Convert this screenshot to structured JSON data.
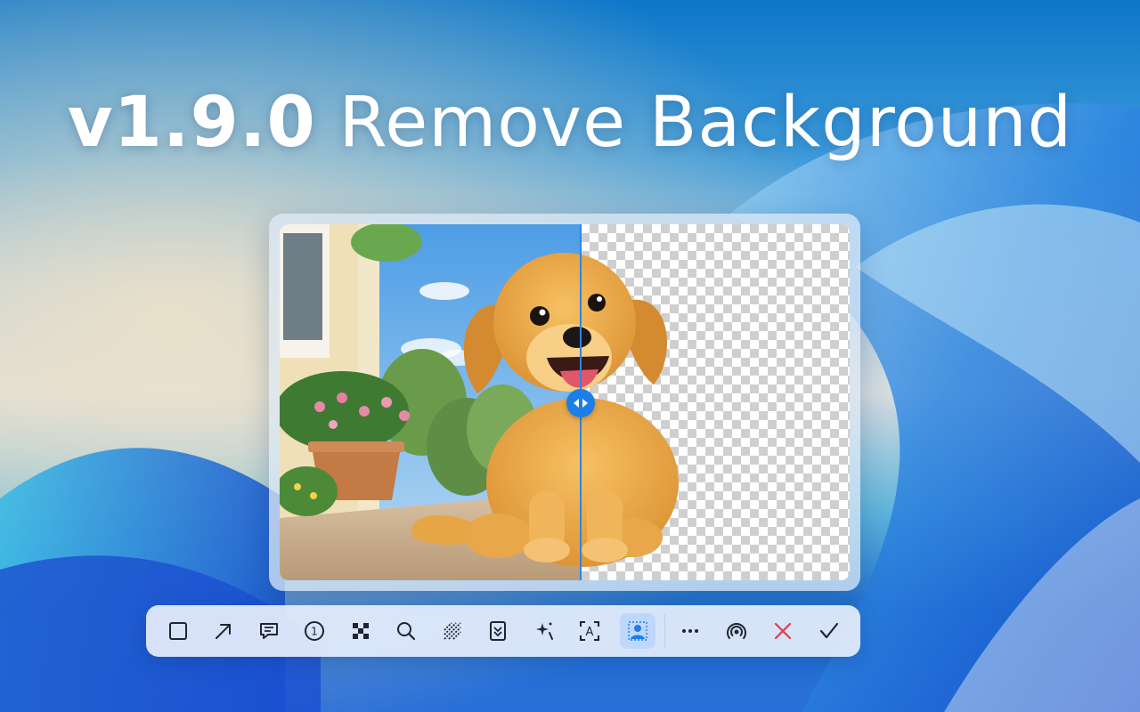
{
  "headline": {
    "version": "v1.9.0",
    "text": "Remove Background"
  },
  "colors": {
    "accent": "#1c7fe8",
    "active_tool_bg": "#bfd7fb",
    "cancel": "#e23a4a",
    "icon": "#1f2430"
  },
  "editor": {
    "mode": "before-after-comparison",
    "split_fraction": 0.53,
    "left_side": "original-photo",
    "right_side": "transparent-background"
  },
  "toolbar": {
    "tools": [
      {
        "name": "rectangle-tool",
        "icon": "square-icon"
      },
      {
        "name": "arrow-tool",
        "icon": "arrow-up-right-icon"
      },
      {
        "name": "text-bubble-tool",
        "icon": "speech-bubble-icon"
      },
      {
        "name": "step-number-tool",
        "icon": "circled-number-icon",
        "glyph": "1"
      },
      {
        "name": "mosaic-tool",
        "icon": "mosaic-icon"
      },
      {
        "name": "magnifier-tool",
        "icon": "search-icon"
      },
      {
        "name": "blur-tool",
        "icon": "hatch-lines-icon"
      },
      {
        "name": "highlight-tool",
        "icon": "marker-icon"
      },
      {
        "name": "magic-tool",
        "icon": "sparkle-icon"
      },
      {
        "name": "ocr-tool",
        "icon": "text-recognize-icon",
        "glyph": "A"
      },
      {
        "name": "remove-background-tool",
        "icon": "person-cutout-icon",
        "active": true
      },
      {
        "name": "more-button",
        "icon": "more-dots-icon"
      },
      {
        "name": "pin-button",
        "icon": "broadcast-icon"
      },
      {
        "name": "cancel-button",
        "icon": "close-icon"
      },
      {
        "name": "confirm-button",
        "icon": "check-icon"
      }
    ]
  }
}
